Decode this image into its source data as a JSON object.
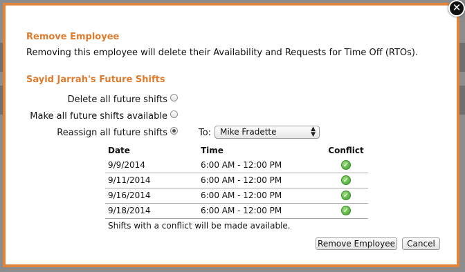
{
  "dialog": {
    "remove_heading": "Remove Employee",
    "remove_description": "Removing this employee will delete their Availability and Requests for Time Off (RTOs).",
    "shifts_heading": "Sayid Jarrah's Future Shifts",
    "options": [
      {
        "label": "Delete all future shifts",
        "selected": false
      },
      {
        "label": "Make all future shifts available",
        "selected": false
      },
      {
        "label": "Reassign all future shifts",
        "selected": true
      }
    ],
    "reassign_to_label": "To:",
    "reassign_to_value": "Mike Fradette",
    "table": {
      "headers": [
        "Date",
        "Time",
        "Conflict"
      ],
      "rows": [
        {
          "date": "9/9/2014",
          "time": "6:00 AM - 12:00 PM",
          "conflict_icon": "check-circle-green"
        },
        {
          "date": "9/11/2014",
          "time": "6:00 AM - 12:00 PM",
          "conflict_icon": "check-circle-green"
        },
        {
          "date": "9/16/2014",
          "time": "6:00 AM - 12:00 PM",
          "conflict_icon": "check-circle-green"
        },
        {
          "date": "9/18/2014",
          "time": "6:00 AM - 12:00 PM",
          "conflict_icon": "check-circle-green"
        }
      ]
    },
    "conflict_note": "Shifts with a conflict will be made available.",
    "remove_button": "Remove Employee",
    "cancel_button": "Cancel",
    "close_icon": "close-x"
  },
  "colors": {
    "accent": "#e07a2c",
    "dialog_border": "#e2843a",
    "ok_green": "#3a9b2a"
  }
}
